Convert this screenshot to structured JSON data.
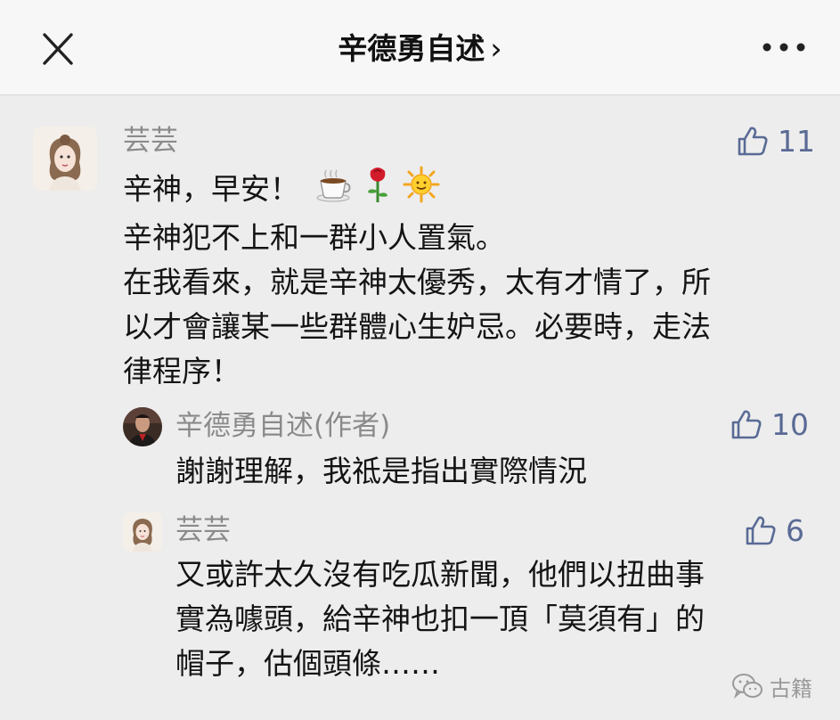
{
  "header": {
    "title": "辛德勇自述",
    "chevron": "›",
    "close_icon": "close-icon",
    "more_icon": "more-icon"
  },
  "comments": [
    {
      "author": "芸芸",
      "likes": "11",
      "emoji": [
        "coffee-cup",
        "rose",
        "sun"
      ],
      "lines": [
        "辛神，早安！",
        "辛神犯不上和一群小人置氣。",
        "在我看來，就是辛神太優秀，太有才情了，所",
        "以才會讓某一些群體心生妒忌。必要時，走法",
        "律程序！"
      ]
    }
  ],
  "replies": [
    {
      "author": "辛德勇自述(作者)",
      "likes": "10",
      "lines": [
        "謝謝理解，我祗是指出實際情況"
      ]
    },
    {
      "author": "芸芸",
      "likes": "6",
      "lines": [
        "又或許太久沒有吃瓜新聞，他們以扭曲事",
        "實為噱頭，給辛神也扣一頂「莫須有」的",
        "帽子，估個頭條……"
      ]
    }
  ],
  "watermark": {
    "text": "古籍",
    "icon": "wechat-icon"
  },
  "colors": {
    "like": "#596a95",
    "name": "#8a8a8a",
    "background": "#ededed",
    "header": "#f7f7f7"
  }
}
